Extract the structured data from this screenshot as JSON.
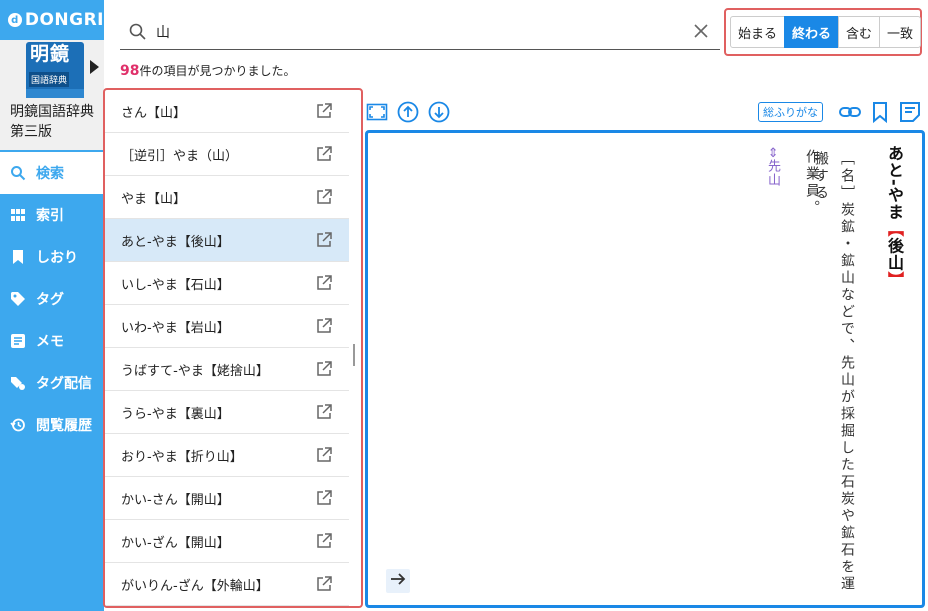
{
  "app": {
    "logo_text": "DONGRI",
    "book_cover_big": "明鏡",
    "book_cover_small": "国語辞典",
    "book_title": "明鏡国語辞典第三版"
  },
  "nav": {
    "items": [
      {
        "label": "検索"
      },
      {
        "label": "索引"
      },
      {
        "label": "しおり"
      },
      {
        "label": "タグ"
      },
      {
        "label": "メモ"
      },
      {
        "label": "タグ配信"
      },
      {
        "label": "閲覧履歴"
      }
    ]
  },
  "search": {
    "value": "山",
    "placeholder": ""
  },
  "modes": [
    "始まる",
    "終わる",
    "含む",
    "一致"
  ],
  "active_mode": "終わる",
  "results": {
    "count": "98",
    "count_suffix": "件の項目が見つかりました。",
    "items": [
      {
        "label": "さん【山】"
      },
      {
        "label": "［逆引］やま（山）"
      },
      {
        "label": "やま【山】"
      },
      {
        "label": "あと-やま【後山】"
      },
      {
        "label": "いし-やま【石山】"
      },
      {
        "label": "いわ-やま【岩山】"
      },
      {
        "label": "うばすて-やま【姥捨山】"
      },
      {
        "label": "うら-やま【裏山】"
      },
      {
        "label": "おり-やま【折り山】"
      },
      {
        "label": "かい-さん【開山】"
      },
      {
        "label": "かい-ざん【開山】"
      },
      {
        "label": "がいりん-ざん【外輪山】"
      }
    ],
    "selected_index": 3
  },
  "toolbar": {
    "furigana_label": "総ふりがな"
  },
  "entry": {
    "headword": "あと-やま",
    "kanji_open": "【",
    "kanji": "後山",
    "kanji_close": "】",
    "definition_1": "［名］炭鉱・鉱山などで、先山が採掘した石炭や鉱石を運搬する",
    "definition_2": "作業員。",
    "antonym": "⇔先山"
  },
  "colors": {
    "sidebar": "#3da8ee",
    "accent": "#1a88e6",
    "highlight_border": "#e06060",
    "count_color": "#e0306a"
  }
}
